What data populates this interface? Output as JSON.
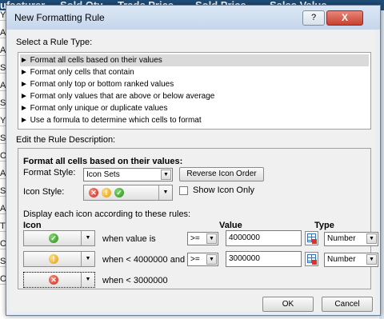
{
  "sheet": {
    "headers": [
      "ufacturer",
      "Sold Qty",
      "Trade Price",
      "Sold Price",
      "Sales Value"
    ],
    "left_column": [
      "Y",
      "A",
      "A",
      "S",
      "A",
      "S",
      "Y",
      "S",
      "O",
      "A",
      "S",
      "A",
      "T",
      "O",
      "S",
      "O"
    ]
  },
  "dialog": {
    "title": "New Formatting Rule",
    "help": "?",
    "close": "X",
    "select_rule_type_label": "Select a Rule Type:",
    "rule_types": [
      "► Format all cells based on their values",
      "► Format only cells that contain",
      "► Format only top or bottom ranked values",
      "► Format only values that are above or below average",
      "► Format only unique or duplicate values",
      "► Use a formula to determine which cells to format"
    ],
    "edit_description_label": "Edit the Rule Description:",
    "format_all_label": "Format all cells based on their values:",
    "format_style_label": "Format Style:",
    "format_style_value": "Icon Sets",
    "reverse_icon_order": "Reverse Icon Order",
    "icon_style_label": "Icon Style:",
    "show_icon_only": "Show Icon Only",
    "display_rules_label": "Display each icon according to these rules:",
    "col_icon": "Icon",
    "col_value": "Value",
    "col_type": "Type",
    "rules": [
      {
        "icon": "green-check-icon",
        "condition": "when value is",
        "operator": ">=",
        "value": "4000000",
        "type": "Number"
      },
      {
        "icon": "yellow-exclamation-icon",
        "condition": "when < 4000000 and",
        "operator": ">=",
        "value": "3000000",
        "type": "Number"
      },
      {
        "icon": "red-x-icon",
        "condition": "when < 3000000"
      }
    ],
    "ok": "OK",
    "cancel": "Cancel"
  }
}
